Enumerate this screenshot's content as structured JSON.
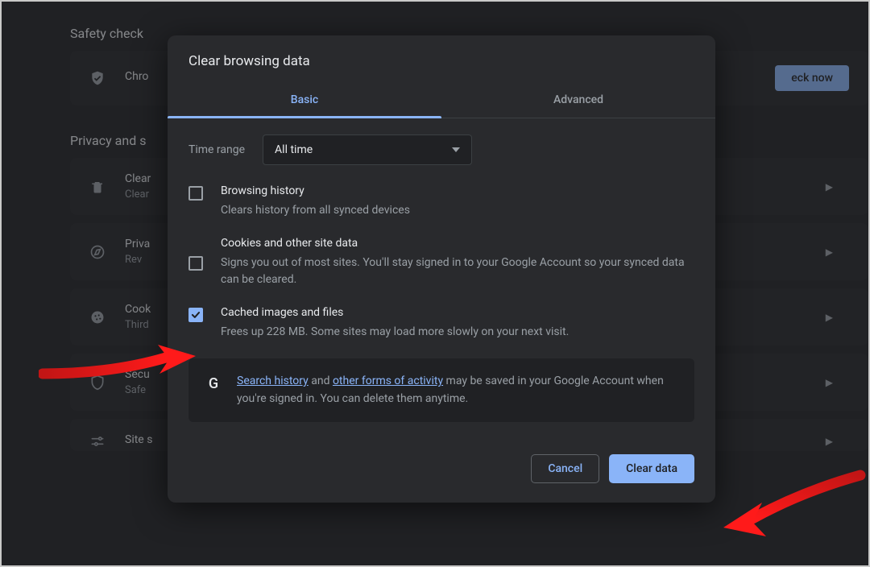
{
  "background": {
    "safetyTitle": "Safety check",
    "safetyText": "Chro",
    "checkNowBtn": "eck now",
    "privacyTitle": "Privacy and s",
    "rows": [
      {
        "t1": "Clear",
        "t2": "Clear"
      },
      {
        "t1": "Priva",
        "t2": "Rev"
      },
      {
        "t1": "Cook",
        "t2": "Third"
      },
      {
        "t1": "Secu",
        "t2": "Safe"
      },
      {
        "t1": "Site s",
        "t2": ""
      }
    ]
  },
  "modal": {
    "title": "Clear browsing data",
    "tabs": {
      "basic": "Basic",
      "advanced": "Advanced"
    },
    "timeLabel": "Time range",
    "timeValue": "All time",
    "options": [
      {
        "title": "Browsing history",
        "desc": "Clears history from all synced devices",
        "checked": false
      },
      {
        "title": "Cookies and other site data",
        "desc": "Signs you out of most sites. You'll stay signed in to your Google Account so your synced data can be cleared.",
        "checked": false
      },
      {
        "title": "Cached images and files",
        "desc": "Frees up 228 MB. Some sites may load more slowly on your next visit.",
        "checked": true
      }
    ],
    "notice": {
      "link1": "Search history",
      "mid1": " and ",
      "link2": "other forms of activity",
      "rest": " may be saved in your Google Account when you're signed in. You can delete them anytime."
    },
    "cancel": "Cancel",
    "clear": "Clear data"
  }
}
